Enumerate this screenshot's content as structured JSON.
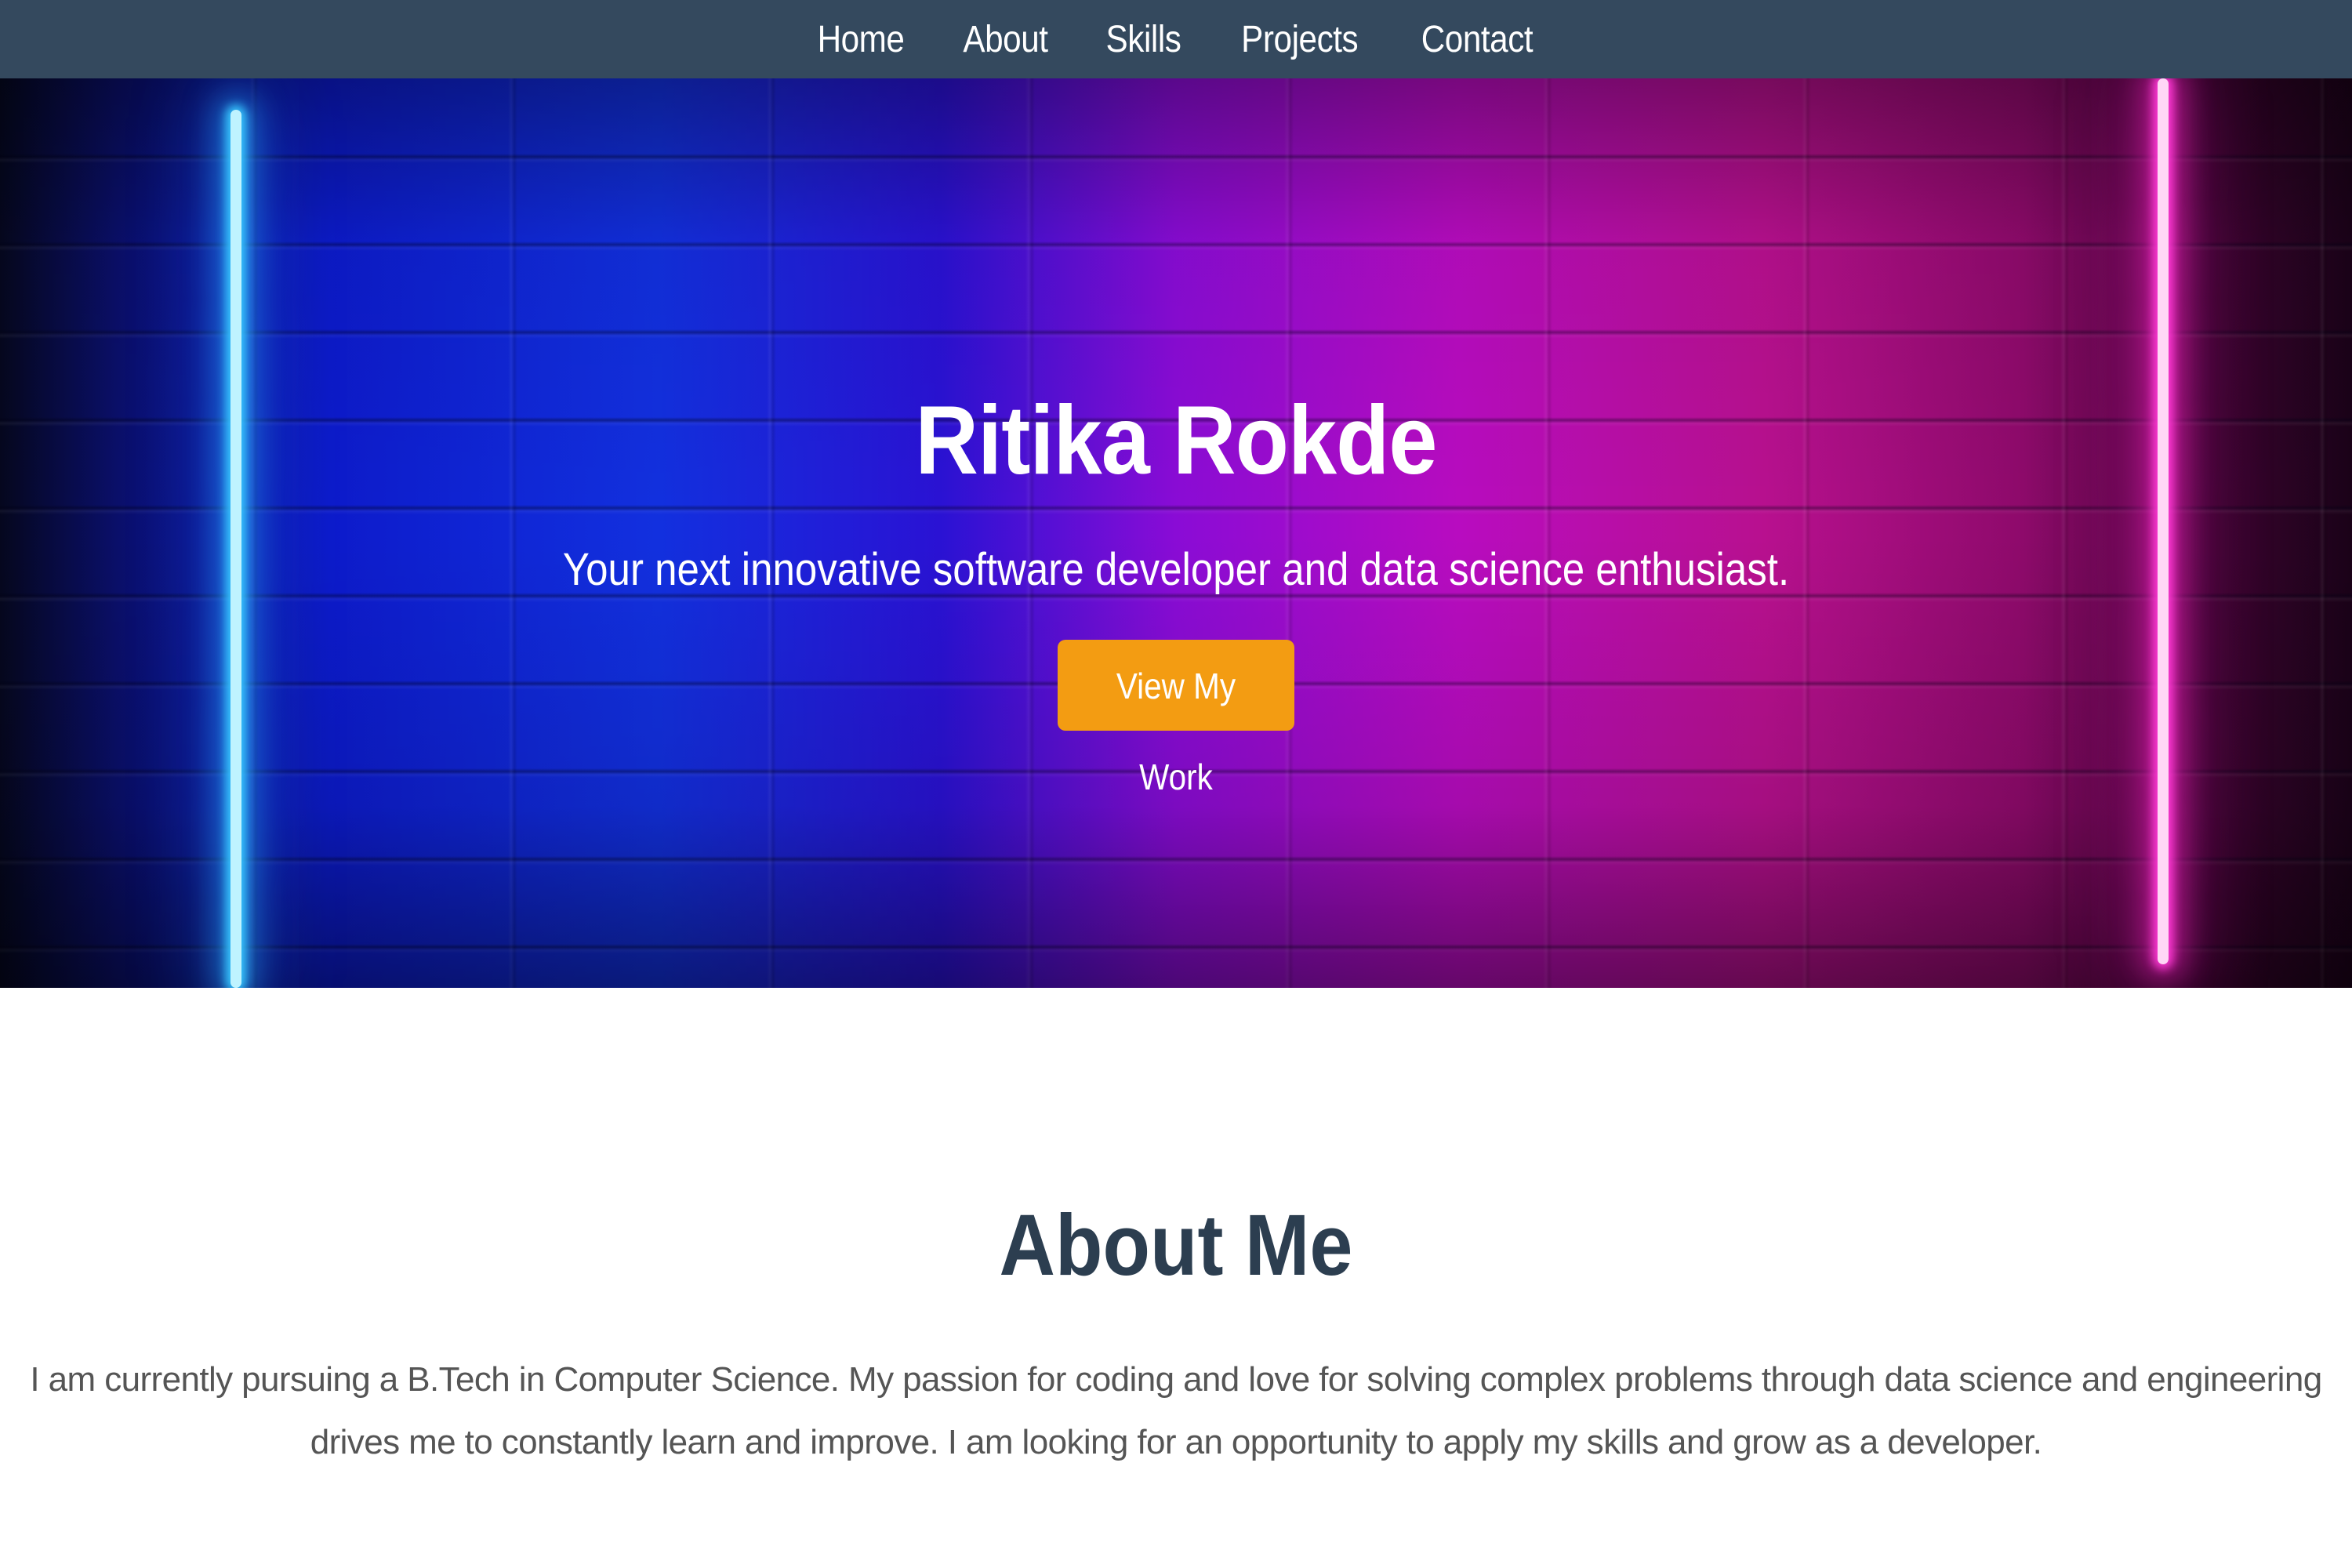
{
  "nav": {
    "items": [
      {
        "label": "Home"
      },
      {
        "label": "About"
      },
      {
        "label": "Skills"
      },
      {
        "label": "Projects"
      },
      {
        "label": "Contact"
      }
    ]
  },
  "hero": {
    "title": "Ritika Rokde",
    "subtitle": "Your next innovative software developer and data science enthusiast.",
    "cta_label": "View My Work"
  },
  "about": {
    "title": "About Me",
    "text": "I am currently pursuing a B.Tech in Computer Science. My passion for coding and love for solving complex problems through data science and engineering drives me to constantly learn and improve. I am looking for an opportunity to apply my skills and grow as a developer."
  },
  "colors": {
    "nav_bg": "#34495e",
    "cta_bg": "#f39c12",
    "heading": "#2c3e50",
    "body_text": "#555555"
  }
}
